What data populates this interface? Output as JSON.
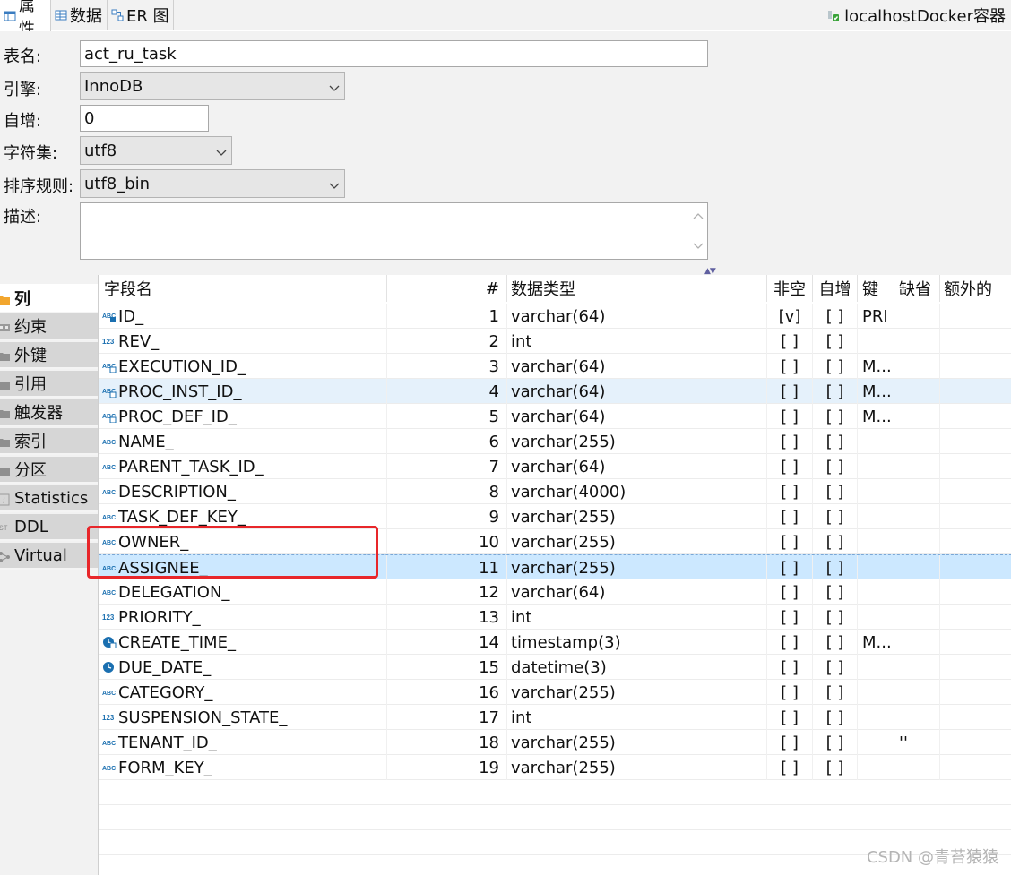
{
  "tabs": [
    {
      "label": "属性",
      "icon": "properties-icon"
    },
    {
      "label": "数据",
      "icon": "data-grid-icon"
    },
    {
      "label": "ER 图",
      "icon": "er-diagram-icon"
    }
  ],
  "connection": {
    "label": "localhostDocker容器",
    "icon": "database-connection-icon"
  },
  "form": {
    "table_name_label": "表名:",
    "table_name_value": "act_ru_task",
    "engine_label": "引擎:",
    "engine_value": "InnoDB",
    "auto_inc_label": "自增:",
    "auto_inc_value": "0",
    "charset_label": "字符集:",
    "charset_value": "utf8",
    "collation_label": "排序规则:",
    "collation_value": "utf8_bin",
    "description_label": "描述:",
    "description_value": ""
  },
  "nav": [
    {
      "label": "列",
      "icon": "folder-icon",
      "active": true
    },
    {
      "label": "约束",
      "icon": "constraint-icon"
    },
    {
      "label": "外键",
      "icon": "folder-icon"
    },
    {
      "label": "引用",
      "icon": "folder-icon"
    },
    {
      "label": "触发器",
      "icon": "folder-icon"
    },
    {
      "label": "索引",
      "icon": "folder-icon"
    },
    {
      "label": "分区",
      "icon": "folder-icon"
    },
    {
      "label": "Statistics",
      "icon": "info-icon"
    },
    {
      "label": "DDL",
      "icon": "ddl-icon"
    },
    {
      "label": "Virtual",
      "icon": "virtual-icon"
    }
  ],
  "columns_header": {
    "name": "字段名",
    "num": "#",
    "type": "数据类型",
    "not_null": "非空",
    "auto_inc": "自增",
    "key": "键",
    "default": "缺省",
    "extra": "额外的"
  },
  "rows": [
    {
      "icon": "string-key-icon",
      "name": "ID_",
      "num": "1",
      "type": "varchar(64)",
      "not_null": "[v]",
      "auto_inc": "[ ]",
      "key": "PRI",
      "default": ""
    },
    {
      "icon": "number-icon",
      "name": "REV_",
      "num": "2",
      "type": "int",
      "not_null": "[ ]",
      "auto_inc": "[ ]",
      "key": "",
      "default": ""
    },
    {
      "icon": "string-index-icon",
      "name": "EXECUTION_ID_",
      "num": "3",
      "type": "varchar(64)",
      "not_null": "[ ]",
      "auto_inc": "[ ]",
      "key": "M...",
      "default": ""
    },
    {
      "icon": "string-index-icon",
      "name": "PROC_INST_ID_",
      "num": "4",
      "type": "varchar(64)",
      "not_null": "[ ]",
      "auto_inc": "[ ]",
      "key": "M...",
      "default": ""
    },
    {
      "icon": "string-index-icon",
      "name": "PROC_DEF_ID_",
      "num": "5",
      "type": "varchar(64)",
      "not_null": "[ ]",
      "auto_inc": "[ ]",
      "key": "M...",
      "default": ""
    },
    {
      "icon": "string-icon",
      "name": "NAME_",
      "num": "6",
      "type": "varchar(255)",
      "not_null": "[ ]",
      "auto_inc": "[ ]",
      "key": "",
      "default": ""
    },
    {
      "icon": "string-icon",
      "name": "PARENT_TASK_ID_",
      "num": "7",
      "type": "varchar(64)",
      "not_null": "[ ]",
      "auto_inc": "[ ]",
      "key": "",
      "default": ""
    },
    {
      "icon": "string-icon",
      "name": "DESCRIPTION_",
      "num": "8",
      "type": "varchar(4000)",
      "not_null": "[ ]",
      "auto_inc": "[ ]",
      "key": "",
      "default": ""
    },
    {
      "icon": "string-icon",
      "name": "TASK_DEF_KEY_",
      "num": "9",
      "type": "varchar(255)",
      "not_null": "[ ]",
      "auto_inc": "[ ]",
      "key": "",
      "default": ""
    },
    {
      "icon": "string-icon",
      "name": "OWNER_",
      "num": "10",
      "type": "varchar(255)",
      "not_null": "[ ]",
      "auto_inc": "[ ]",
      "key": "",
      "default": ""
    },
    {
      "icon": "string-icon",
      "name": "ASSIGNEE_",
      "num": "11",
      "type": "varchar(255)",
      "not_null": "[ ]",
      "auto_inc": "[ ]",
      "key": "",
      "default": ""
    },
    {
      "icon": "string-icon",
      "name": "DELEGATION_",
      "num": "12",
      "type": "varchar(64)",
      "not_null": "[ ]",
      "auto_inc": "[ ]",
      "key": "",
      "default": ""
    },
    {
      "icon": "number-icon",
      "name": "PRIORITY_",
      "num": "13",
      "type": "int",
      "not_null": "[ ]",
      "auto_inc": "[ ]",
      "key": "",
      "default": ""
    },
    {
      "icon": "clock-index-icon",
      "name": "CREATE_TIME_",
      "num": "14",
      "type": "timestamp(3)",
      "not_null": "[ ]",
      "auto_inc": "[ ]",
      "key": "M...",
      "default": ""
    },
    {
      "icon": "clock-icon",
      "name": "DUE_DATE_",
      "num": "15",
      "type": "datetime(3)",
      "not_null": "[ ]",
      "auto_inc": "[ ]",
      "key": "",
      "default": ""
    },
    {
      "icon": "string-icon",
      "name": "CATEGORY_",
      "num": "16",
      "type": "varchar(255)",
      "not_null": "[ ]",
      "auto_inc": "[ ]",
      "key": "",
      "default": ""
    },
    {
      "icon": "number-icon",
      "name": "SUSPENSION_STATE_",
      "num": "17",
      "type": "int",
      "not_null": "[ ]",
      "auto_inc": "[ ]",
      "key": "",
      "default": ""
    },
    {
      "icon": "string-icon",
      "name": "TENANT_ID_",
      "num": "18",
      "type": "varchar(255)",
      "not_null": "[ ]",
      "auto_inc": "[ ]",
      "key": "",
      "default": "''"
    },
    {
      "icon": "string-icon",
      "name": "FORM_KEY_",
      "num": "19",
      "type": "varchar(255)",
      "not_null": "[ ]",
      "auto_inc": "[ ]",
      "key": "",
      "default": ""
    }
  ],
  "selection": {
    "hover_row": "4",
    "selected_row": "11"
  },
  "colors": {
    "accent": "#1a6fb0",
    "selected": "#cce8ff",
    "hover": "#e5f1fb",
    "highlight_box": "#e8262a"
  },
  "watermark": "CSDN @青苔猿猿"
}
